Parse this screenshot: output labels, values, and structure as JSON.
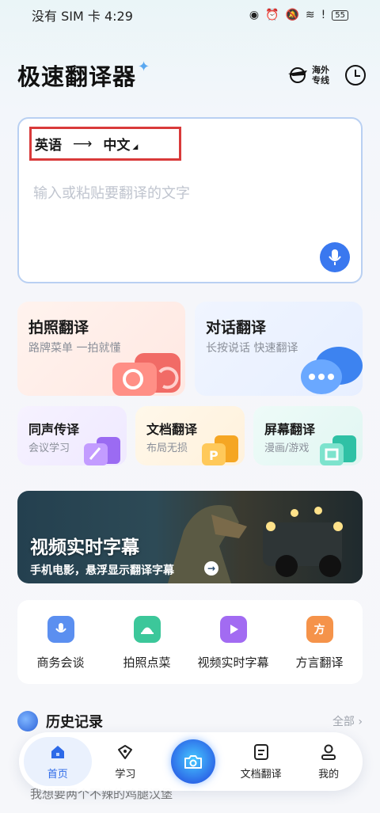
{
  "status_bar": {
    "carrier_time": "没有 SIM 卡 4:29",
    "battery": "55"
  },
  "header": {
    "title": "极速翻译器",
    "overseas_line1": "海外",
    "overseas_line2": "专线"
  },
  "translator": {
    "source_lang": "英语",
    "arrow": "⟶",
    "target_lang": "中文",
    "placeholder": "输入或粘贴要翻译的文字"
  },
  "features": {
    "photo": {
      "title": "拍照翻译",
      "subtitle": "路牌菜单 一拍就懂"
    },
    "dialog": {
      "title": "对话翻译",
      "subtitle": "长按说话 快速翻译"
    },
    "simultaneous": {
      "title": "同声传译",
      "subtitle": "会议学习"
    },
    "document": {
      "title": "文档翻译",
      "subtitle": "布局无损"
    },
    "screen": {
      "title": "屏幕翻译",
      "subtitle": "漫画/游戏"
    }
  },
  "banner": {
    "title": "视频实时字幕",
    "subtitle": "手机电影，悬浮显示翻译字幕"
  },
  "quick_tools": [
    {
      "label": "商务会谈",
      "color": "#5b8ff0"
    },
    {
      "label": "拍照点菜",
      "color": "#3cc79a"
    },
    {
      "label": "视频实时字幕",
      "color": "#a26bf2"
    },
    {
      "label": "方言翻译",
      "color": "#f5934a",
      "glyph": "方"
    }
  ],
  "history": {
    "title": "历史记录",
    "all": "全部 ›",
    "peek": "我想要两个不辣的鸡腿汉堡"
  },
  "bottom_nav": {
    "home": "首页",
    "learn": "学习",
    "docs": "文档翻译",
    "mine": "我的"
  }
}
